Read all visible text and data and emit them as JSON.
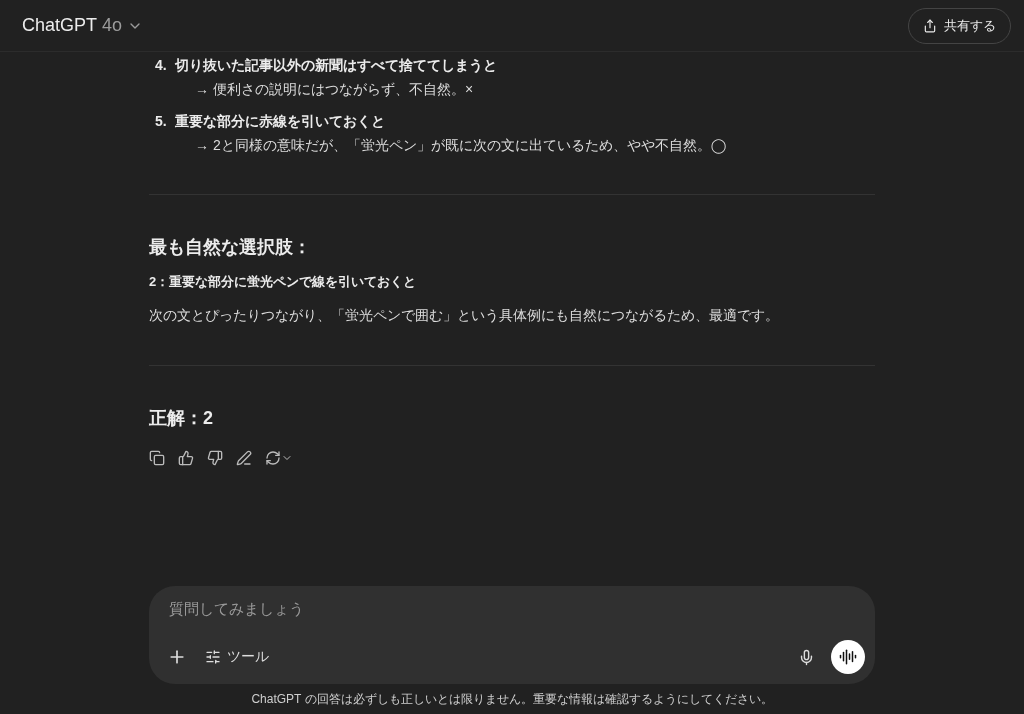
{
  "header": {
    "title": "ChatGPT",
    "model": "4o",
    "share_button": "共有する"
  },
  "list": [
    {
      "number": "4.",
      "title": "切り抜いた記事以外の新聞はすべて捨ててしまうと",
      "note": "→ 便利さの説明にはつながらず、不自然。×"
    },
    {
      "number": "5.",
      "title": "重要な部分に赤線を引いておくと",
      "note": "→ 2と同様の意味だが、「蛍光ペン」が既に次の文に出ているため、やや不自然。◯"
    }
  ],
  "best_choice": {
    "heading": "最も自然な選択肢：",
    "choice": "2：重要な部分に蛍光ペンで線を引いておくと",
    "reason": "次の文とぴったりつながり、「蛍光ペンで囲む」という具体例にも自然につながるため、最適です。"
  },
  "answer": {
    "heading": "正解：2"
  },
  "composer": {
    "placeholder": "質問してみましょう",
    "tools_button": "ツール"
  },
  "disclaimer": "ChatGPT の回答は必ずしも正しいとは限りません。重要な情報は確認するようにしてください。"
}
